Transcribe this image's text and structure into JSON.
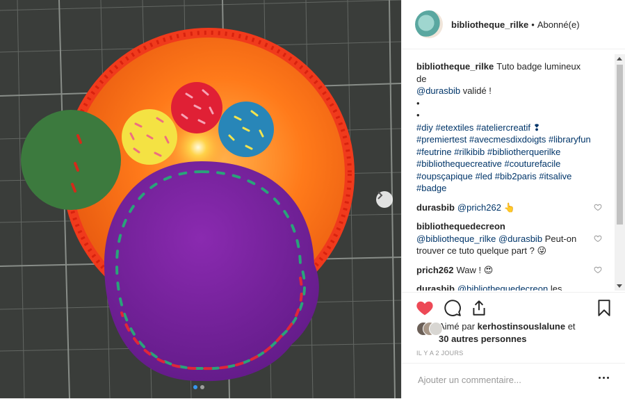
{
  "header": {
    "username": "bibliotheque_rilke",
    "separator": "•",
    "follow_status": "Abonné(e)"
  },
  "caption": {
    "username": "bibliotheque_rilke",
    "text_a": "Tuto badge lumineux de",
    "mention": "@durasbib",
    "text_b": "validé !",
    "dot1": "•",
    "dot2": "•",
    "hashtags": "#diy #etextiles #ateliercreatif ❢ #premiertest #avecmesdixdoigts #libraryfun #feutrine #rilkibib #bibliotherquerilke #bibliothequecreative #couturefacile #oupsçapique #led #bib2paris #itsalive #badge"
  },
  "comments": [
    {
      "username": "durasbib",
      "mention": "@prich262",
      "text": "👆"
    },
    {
      "username": "bibliothequedecreon",
      "mention": "@bibliotheque_rilke @durasbib",
      "text": "Peut-on trouver ce tuto quelque part ? 😜"
    },
    {
      "username": "prich262",
      "mention": "",
      "text": "Waw ! 😍"
    },
    {
      "username": "durasbib",
      "mention": "@bibliothequedecreon",
      "text": "les collègues de la bib Rilke justement testaient notre Tuto. On le partage"
    }
  ],
  "likes": {
    "prefix": "Aimé par",
    "user": "kerhostinsouslalune",
    "suffix": "et",
    "others": "30 autres personnes"
  },
  "time": "IL Y A 2 JOURS",
  "add_comment": {
    "placeholder": "Ajouter un commentaire..."
  },
  "icons": {
    "like": "heart-icon-filled",
    "comment": "comment-icon",
    "share": "share-icon",
    "save": "bookmark-icon",
    "next": "chevron-right-icon",
    "more": "more-options-icon"
  },
  "colors": {
    "like_red": "#ed4956",
    "link": "#003569",
    "carousel_active": "#3897f0"
  },
  "carousel": {
    "total": 2,
    "active": 1
  }
}
